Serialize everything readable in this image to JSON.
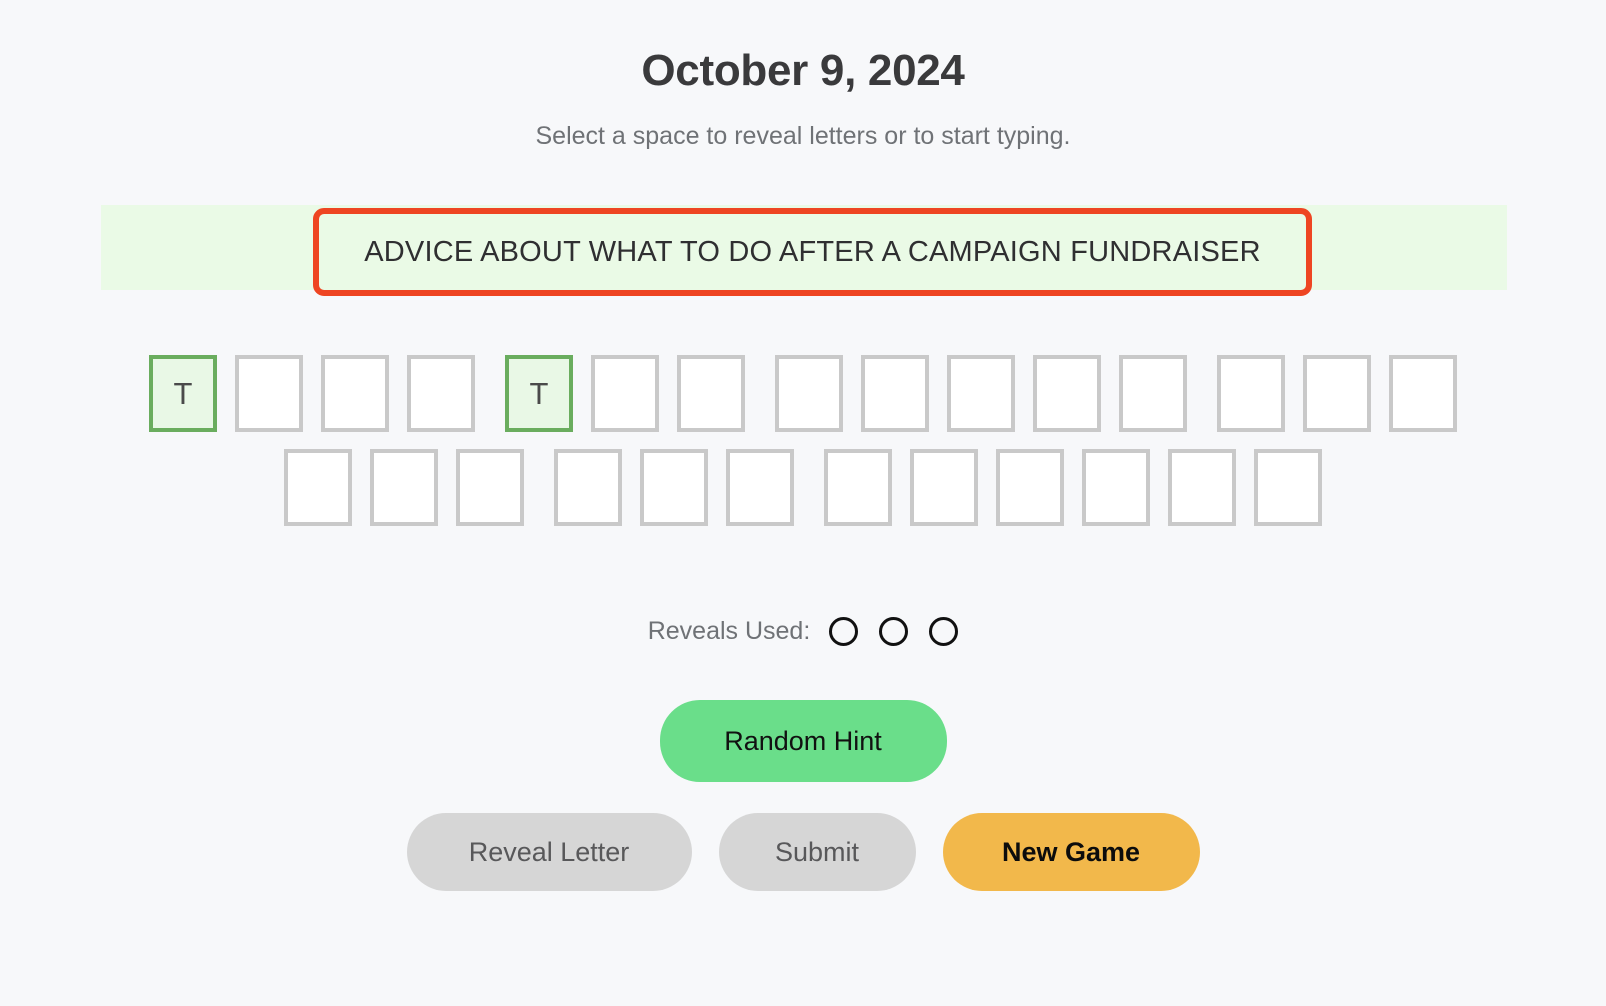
{
  "header": {
    "title": "October 9, 2024",
    "subtitle": "Select a space to reveal letters or to start typing."
  },
  "clue": {
    "text": "ADVICE ABOUT WHAT TO DO AFTER A CAMPAIGN FUNDRAISER",
    "banner_background": "#eafae6",
    "highlight_border_color": "#ee4522"
  },
  "puzzle": {
    "rows": [
      {
        "words": [
          {
            "letters": [
              {
                "char": "T",
                "revealed": true
              },
              {
                "char": "",
                "revealed": false
              },
              {
                "char": "",
                "revealed": false
              },
              {
                "char": "",
                "revealed": false
              }
            ]
          },
          {
            "letters": [
              {
                "char": "T",
                "revealed": true
              },
              {
                "char": "",
                "revealed": false
              },
              {
                "char": "",
                "revealed": false
              }
            ]
          },
          {
            "letters": [
              {
                "char": "",
                "revealed": false
              },
              {
                "char": "",
                "revealed": false
              },
              {
                "char": "",
                "revealed": false
              },
              {
                "char": "",
                "revealed": false
              },
              {
                "char": "",
                "revealed": false
              }
            ]
          },
          {
            "letters": [
              {
                "char": "",
                "revealed": false
              },
              {
                "char": "",
                "revealed": false
              },
              {
                "char": "",
                "revealed": false
              }
            ]
          }
        ]
      },
      {
        "words": [
          {
            "letters": [
              {
                "char": "",
                "revealed": false
              },
              {
                "char": "",
                "revealed": false
              },
              {
                "char": "",
                "revealed": false
              }
            ]
          },
          {
            "letters": [
              {
                "char": "",
                "revealed": false
              },
              {
                "char": "",
                "revealed": false
              },
              {
                "char": "",
                "revealed": false
              }
            ]
          },
          {
            "letters": [
              {
                "char": "",
                "revealed": false
              },
              {
                "char": "",
                "revealed": false
              },
              {
                "char": "",
                "revealed": false
              },
              {
                "char": "",
                "revealed": false
              },
              {
                "char": "",
                "revealed": false
              },
              {
                "char": "",
                "revealed": false
              }
            ]
          }
        ]
      }
    ],
    "tile_border_color": "#c9c9c9",
    "revealed_border_color": "#6aad5e",
    "revealed_background": "#e9f8e6"
  },
  "reveals": {
    "label": "Reveals Used:",
    "total": 3,
    "used": 0,
    "dots": [
      {
        "used": false
      },
      {
        "used": false
      },
      {
        "used": false
      }
    ]
  },
  "buttons": {
    "random_hint": "Random Hint",
    "reveal_letter": "Reveal Letter",
    "submit": "Submit",
    "new_game": "New Game",
    "hint_color": "#6ade8a",
    "gray_color": "#d6d6d6",
    "new_game_color": "#f2b84b"
  }
}
